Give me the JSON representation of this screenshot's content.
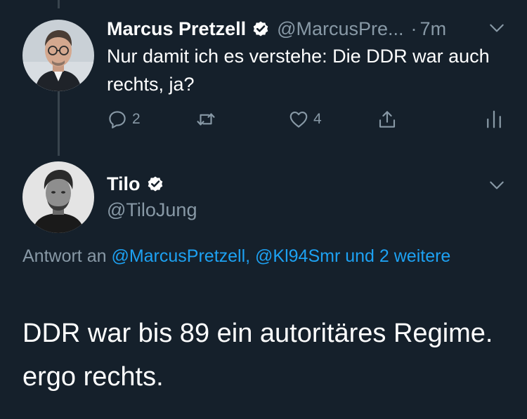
{
  "tweet1": {
    "display_name": "Marcus Pretzell",
    "handle": "@MarcusPre...",
    "separator": "·",
    "time": "7m",
    "text": "Nur damit ich es verstehe: Die DDR war auch rechts, ja?",
    "reply_count": "2",
    "like_count": "4",
    "icons": [
      "reply-icon",
      "retweet-icon",
      "like-icon",
      "share-icon",
      "analytics-icon",
      "chevron-down-icon",
      "verified-badge-icon"
    ]
  },
  "tweet2": {
    "display_name": "Tilo",
    "handle": "@TiloJung",
    "reply_prefix": "Antwort an ",
    "reply_mentions": "@MarcusPretzell, @Kl94Smr und 2 weitere",
    "text": "DDR war bis 89 ein autoritäres Regime. ergo rechts."
  },
  "colors": {
    "background": "#15202b",
    "primary_text": "#ffffff",
    "secondary_text": "#8899a6",
    "accent": "#1da1f2",
    "thread_line": "#38444d"
  }
}
